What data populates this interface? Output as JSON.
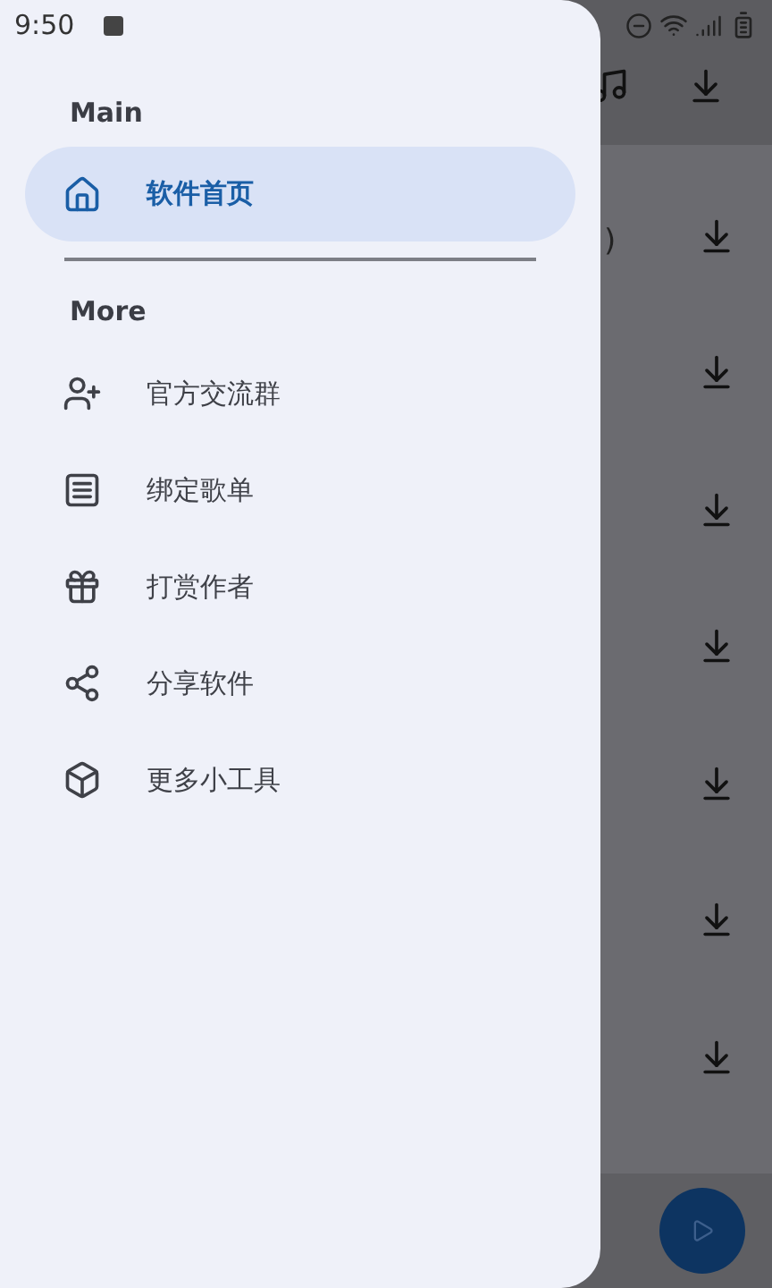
{
  "status_bar": {
    "time": "9:50"
  },
  "background": {
    "rows": [
      {
        "text": ")"
      },
      {},
      {},
      {},
      {},
      {},
      {}
    ]
  },
  "drawer": {
    "sections": [
      {
        "title": "Main",
        "items": [
          {
            "label": "软件首页",
            "kind": "home",
            "selected": true
          }
        ]
      },
      {
        "title": "More",
        "items": [
          {
            "label": "官方交流群",
            "kind": "group",
            "selected": false
          },
          {
            "label": "绑定歌单",
            "kind": "list",
            "selected": false
          },
          {
            "label": "打赏作者",
            "kind": "gift",
            "selected": false
          },
          {
            "label": "分享软件",
            "kind": "share",
            "selected": false
          },
          {
            "label": "更多小工具",
            "kind": "cube",
            "selected": false
          }
        ]
      }
    ]
  }
}
